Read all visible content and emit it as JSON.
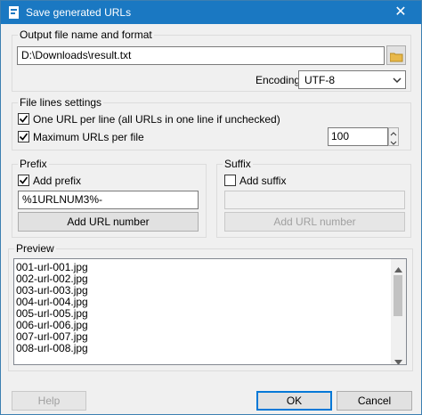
{
  "window": {
    "title": "Save generated URLs",
    "close_glyph": "✕"
  },
  "output": {
    "legend": "Output file name and format",
    "path": "D:\\Downloads\\result.txt",
    "encoding_label": "Encoding",
    "encoding_value": "UTF-8"
  },
  "file_lines": {
    "legend": "File lines settings",
    "one_per_line_label": "One URL per line (all URLs in one line if unchecked)",
    "one_per_line_checked": true,
    "max_urls_label": "Maximum URLs per file",
    "max_urls_checked": true,
    "max_urls_value": "100"
  },
  "prefix": {
    "legend": "Prefix",
    "add_label": "Add prefix",
    "checked": true,
    "value": "%1URLNUM3%-",
    "add_url_button": "Add URL number"
  },
  "suffix": {
    "legend": "Suffix",
    "add_label": "Add suffix",
    "checked": false,
    "value": "",
    "add_url_button": "Add URL number"
  },
  "preview": {
    "legend": "Preview",
    "lines": [
      "001-url-001.jpg",
      "002-url-002.jpg",
      "003-url-003.jpg",
      "004-url-004.jpg",
      "005-url-005.jpg",
      "006-url-006.jpg",
      "007-url-007.jpg",
      "008-url-008.jpg"
    ]
  },
  "buttons": {
    "help": "Help",
    "ok": "OK",
    "cancel": "Cancel"
  },
  "colors": {
    "titlebar": "#1a78c2",
    "folder": "#e8b84a",
    "accent": "#0078d7"
  },
  "icons": {
    "app": "app-icon",
    "folder": "folder-icon",
    "dropdown": "chevron-down-icon",
    "check": "checkmark-icon"
  }
}
